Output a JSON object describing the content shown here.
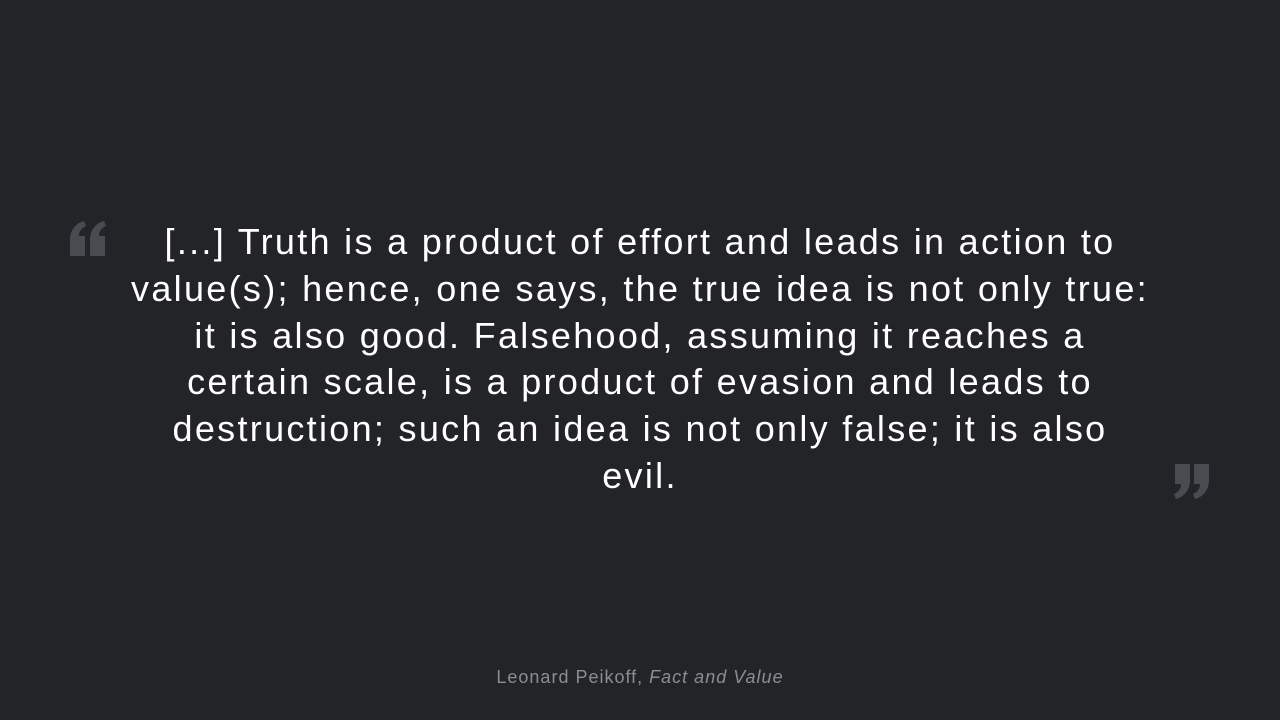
{
  "quote": {
    "text": "[...] Truth is a product of effort and leads in action to value(s); hence, one says, the true idea is not only true: it is also good. Falsehood, assuming it reaches a certain scale, is a product of evasion and leads to destruction; such an idea is not only false; it is also evil.",
    "open_icon": "open-quote-icon",
    "close_icon": "close-quote-icon"
  },
  "attribution": {
    "author": "Leonard Peikoff",
    "separator": ", ",
    "work": "Fact and Value"
  },
  "colors": {
    "background": "#232428",
    "text": "#ffffff",
    "attribution": "#8c8d93",
    "quote_marks": "#4a4b50"
  }
}
